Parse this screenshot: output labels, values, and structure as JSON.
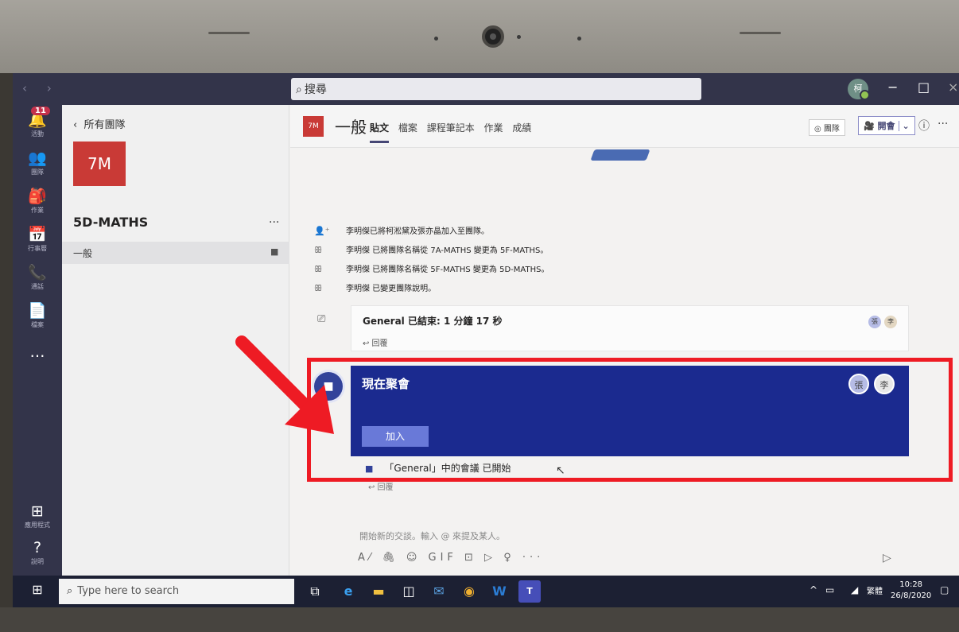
{
  "titlebar": {
    "nav_arrows": "‹ ›",
    "search_placeholder": "搜尋",
    "profile_initial": "柯",
    "minimize": "−",
    "restore": "□",
    "close": "×"
  },
  "rail": {
    "items": [
      {
        "icon": "bell-icon",
        "glyph": "🔔",
        "label": "活動",
        "badge": "11"
      },
      {
        "icon": "teams-icon",
        "glyph": "👥",
        "label": "團隊"
      },
      {
        "icon": "assignments-icon",
        "glyph": "🎒",
        "label": "作業"
      },
      {
        "icon": "calendar-icon",
        "glyph": "📅",
        "label": "行事曆"
      },
      {
        "icon": "phone-icon",
        "glyph": "📞",
        "label": "通話"
      },
      {
        "icon": "files-icon",
        "glyph": "📄",
        "label": "檔案"
      },
      {
        "icon": "more-apps-icon",
        "glyph": "…",
        "label": ""
      }
    ],
    "apps_label": "應用程式",
    "help_label": "說明"
  },
  "team_panel": {
    "back_label": "所有團隊",
    "team_tile": "7M",
    "team_name": "5D-MATHS",
    "more": "...",
    "channel": "一般"
  },
  "channel_header": {
    "tile": "7M",
    "title": "一般",
    "tabs": [
      {
        "label": "貼文",
        "active": true
      },
      {
        "label": "檔案",
        "active": false
      },
      {
        "label": "課程筆記本",
        "active": false
      },
      {
        "label": "作業",
        "active": false
      },
      {
        "label": "成績",
        "active": false
      }
    ],
    "team_button": "◎ 團隊",
    "meet_button": "🎥 開會",
    "info": "ⓘ",
    "more": "···"
  },
  "feed": {
    "system_messages": [
      {
        "icon": "person-add-icon",
        "glyph": "👤⁺",
        "text": "李明傑已將柯淞黛及張亦晶加入至團隊。"
      },
      {
        "icon": "team-icon",
        "glyph": "ꕥ",
        "text": "李明傑 已將團隊名稱從 7A-MATHS 變更為 5F-MATHS。"
      },
      {
        "icon": "team-icon",
        "glyph": "ꕥ",
        "text": "李明傑 已將團隊名稱從 5F-MATHS 變更為 5D-MATHS。"
      },
      {
        "icon": "team-icon",
        "glyph": "ꕥ",
        "text": "李明傑 已變更團隊說明。"
      }
    ],
    "ended_meeting": {
      "text": "General 已結束: 1 分鐘 17 秒",
      "reply": "↩ 回覆",
      "avatars": [
        "張",
        "李"
      ]
    },
    "live_meeting": {
      "title": "現在聚會",
      "join": "加入",
      "avatars": [
        "張",
        "李"
      ],
      "started": "「General」中的會議 已開始",
      "reply": "↩ 回覆"
    }
  },
  "compose": {
    "placeholder": "開始新的交談。輸入 @ 來提及某人。",
    "tools": "A⁄ 🖇 ☺ GIF ⊡ ▷ ♀ ···",
    "send": "▷"
  },
  "taskbar": {
    "search_placeholder": "Type here to search",
    "tray_language": "繁體",
    "time": "10:28",
    "date": "26/8/2020"
  },
  "colors": {
    "highlight": "#ee1b24",
    "meeting_card": "#1b2a8f",
    "join_button": "#6979d8",
    "team_tile": "#c93a36",
    "rail": "#33344a"
  }
}
